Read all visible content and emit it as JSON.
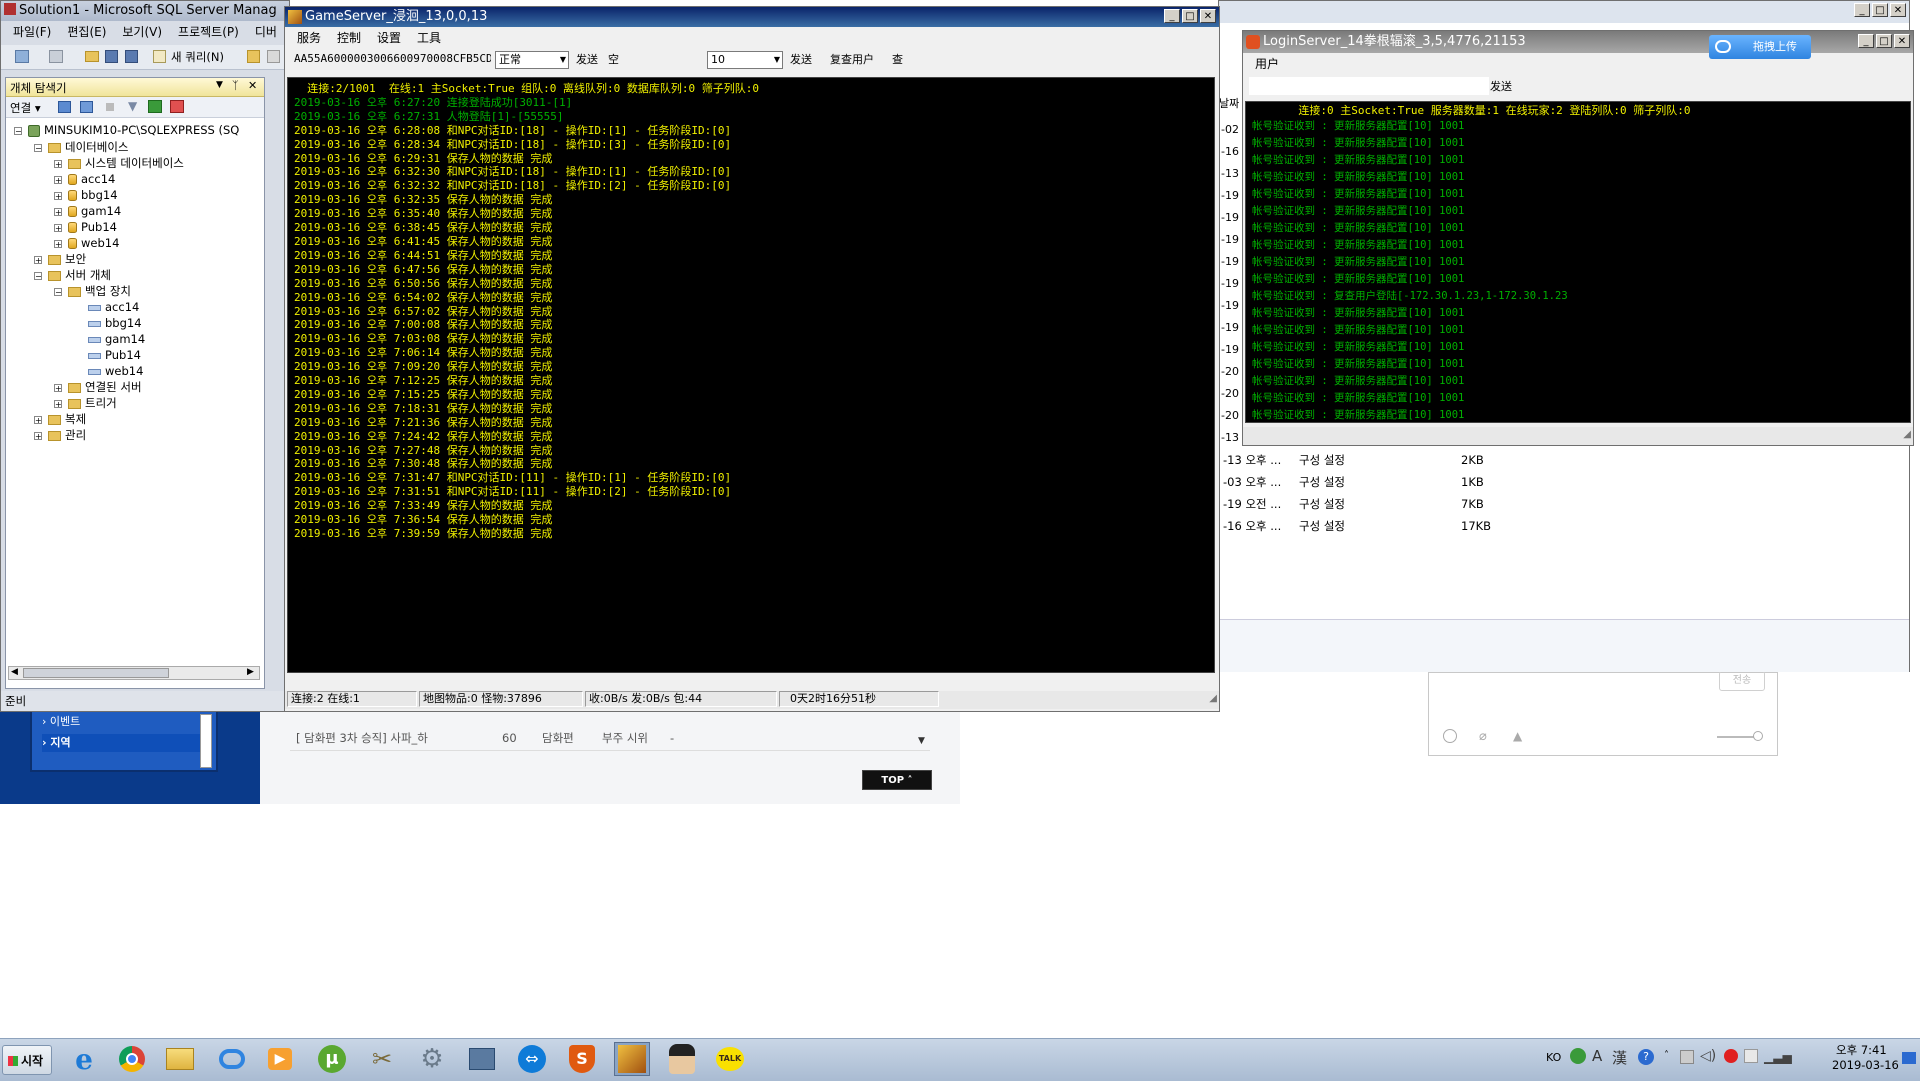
{
  "ssms": {
    "title": "Solution1 - Microsoft SQL Server Manag",
    "menu": [
      "파일(F)",
      "편집(E)",
      "보기(V)",
      "프로젝트(P)",
      "디버"
    ],
    "new_query": "새 쿼리(N)",
    "explorer_title": "개체 탐색기",
    "connect_label": "연결",
    "status": "준비",
    "tree": [
      {
        "label": "MINSUKIM10-PC\\SQLEXPRESS (SQ",
        "icon": "server-icon",
        "level": 0
      },
      {
        "label": "데이터베이스",
        "icon": "folder-icon",
        "level": 1
      },
      {
        "label": "시스템 데이터베이스",
        "icon": "folder-icon",
        "level": 2
      },
      {
        "label": "acc14",
        "icon": "database-icon",
        "level": 2
      },
      {
        "label": "bbg14",
        "icon": "database-icon",
        "level": 2
      },
      {
        "label": "gam14",
        "icon": "database-icon",
        "level": 2
      },
      {
        "label": "Pub14",
        "icon": "database-icon",
        "level": 2
      },
      {
        "label": "web14",
        "icon": "database-icon",
        "level": 2
      },
      {
        "label": "보안",
        "icon": "folder-icon",
        "level": 1
      },
      {
        "label": "서버 개체",
        "icon": "folder-icon",
        "level": 1
      },
      {
        "label": "백업 장치",
        "icon": "folder-icon",
        "level": 2
      },
      {
        "label": "acc14",
        "icon": "backup-device-icon",
        "level": 3
      },
      {
        "label": "bbg14",
        "icon": "backup-device-icon",
        "level": 3
      },
      {
        "label": "gam14",
        "icon": "backup-device-icon",
        "level": 3
      },
      {
        "label": "Pub14",
        "icon": "backup-device-icon",
        "level": 3
      },
      {
        "label": "web14",
        "icon": "backup-device-icon",
        "level": 3
      },
      {
        "label": "연결된 서버",
        "icon": "folder-icon",
        "level": 2
      },
      {
        "label": "트리거",
        "icon": "folder-icon",
        "level": 2
      },
      {
        "label": "복제",
        "icon": "folder-icon",
        "level": 1
      },
      {
        "label": "관리",
        "icon": "folder-icon",
        "level": 1
      }
    ]
  },
  "game_server": {
    "title": "GameServer_浸洄_13,0,0,13",
    "menu": [
      "服务",
      "控制",
      "设置",
      "工具"
    ],
    "packet_field": "AA55A6000003006600970008CFB5CD",
    "mode_select": "正常",
    "send1": "发送",
    "space_label": "空",
    "count_field": "10",
    "send2": "发送",
    "query_user": "复查用户",
    "query_short": "查",
    "header_line": "  连接:2/1001  在线:1 主Socket:True 组队:0 离线队列:0 数据库队列:0 筛子列队:0",
    "log": [
      {
        "text": "2019-03-16 오후 6:27:20 连接登陆成功[3011-[1]",
        "color": "green"
      },
      {
        "text": "2019-03-16 오후 6:27:31 人物登陆[1]-[55555]",
        "color": "green"
      },
      {
        "text": "2019-03-16 오후 6:28:08 和NPC对话ID:[18] - 操作ID:[1] - 任务阶段ID:[0]",
        "color": "yellow"
      },
      {
        "text": "2019-03-16 오후 6:28:34 和NPC对话ID:[18] - 操作ID:[3] - 任务阶段ID:[0]",
        "color": "yellow"
      },
      {
        "text": "2019-03-16 오후 6:29:31 保存人物的数据 完成",
        "color": "yellow"
      },
      {
        "text": "2019-03-16 오후 6:32:30 和NPC对话ID:[18] - 操作ID:[1] - 任务阶段ID:[0]",
        "color": "yellow"
      },
      {
        "text": "2019-03-16 오후 6:32:32 和NPC对话ID:[18] - 操作ID:[2] - 任务阶段ID:[0]",
        "color": "yellow"
      },
      {
        "text": "2019-03-16 오후 6:32:35 保存人物的数据 完成",
        "color": "yellow"
      },
      {
        "text": "2019-03-16 오후 6:35:40 保存人物的数据 完成",
        "color": "yellow"
      },
      {
        "text": "2019-03-16 오후 6:38:45 保存人物的数据 完成",
        "color": "yellow"
      },
      {
        "text": "2019-03-16 오후 6:41:45 保存人物的数据 完成",
        "color": "yellow"
      },
      {
        "text": "2019-03-16 오후 6:44:51 保存人物的数据 完成",
        "color": "yellow"
      },
      {
        "text": "2019-03-16 오후 6:47:56 保存人物的数据 完成",
        "color": "yellow"
      },
      {
        "text": "2019-03-16 오후 6:50:56 保存人物的数据 完成",
        "color": "yellow"
      },
      {
        "text": "2019-03-16 오후 6:54:02 保存人物的数据 完成",
        "color": "yellow"
      },
      {
        "text": "2019-03-16 오후 6:57:02 保存人物的数据 完成",
        "color": "yellow"
      },
      {
        "text": "2019-03-16 오후 7:00:08 保存人物的数据 完成",
        "color": "yellow"
      },
      {
        "text": "2019-03-16 오후 7:03:08 保存人物的数据 完成",
        "color": "yellow"
      },
      {
        "text": "2019-03-16 오후 7:06:14 保存人物的数据 完成",
        "color": "yellow"
      },
      {
        "text": "2019-03-16 오후 7:09:20 保存人物的数据 完成",
        "color": "yellow"
      },
      {
        "text": "2019-03-16 오후 7:12:25 保存人物的数据 完成",
        "color": "yellow"
      },
      {
        "text": "2019-03-16 오후 7:15:25 保存人物的数据 完成",
        "color": "yellow"
      },
      {
        "text": "2019-03-16 오후 7:18:31 保存人物的数据 完成",
        "color": "yellow"
      },
      {
        "text": "2019-03-16 오후 7:21:36 保存人物的数据 完成",
        "color": "yellow"
      },
      {
        "text": "2019-03-16 오후 7:24:42 保存人物的数据 完成",
        "color": "yellow"
      },
      {
        "text": "2019-03-16 오후 7:27:48 保存人物的数据 完成",
        "color": "yellow"
      },
      {
        "text": "2019-03-16 오후 7:30:48 保存人物的数据 完成",
        "color": "yellow"
      },
      {
        "text": "2019-03-16 오후 7:31:47 和NPC对话ID:[11] - 操作ID:[1] - 任务阶段ID:[0]",
        "color": "yellow"
      },
      {
        "text": "2019-03-16 오후 7:31:51 和NPC对话ID:[11] - 操作ID:[2] - 任务阶段ID:[0]",
        "color": "yellow"
      },
      {
        "text": "2019-03-16 오후 7:33:49 保存人物的数据 完成",
        "color": "yellow"
      },
      {
        "text": "2019-03-16 오후 7:36:54 保存人物的数据 完成",
        "color": "yellow"
      },
      {
        "text": "2019-03-16 오후 7:39:59 保存人物的数据 完成",
        "color": "yellow"
      }
    ],
    "status": [
      "连接:2 在线:1",
      "地图物品:0 怪物:37896",
      "收:0B/s 发:0B/s 包:44",
      "0天2时16分51秒"
    ]
  },
  "login_server": {
    "title": "LoginServer_14拳根辐滚_3,5,4776,21153",
    "menu": [
      "用户"
    ],
    "send": "发送",
    "upload_label": "拖拽上传",
    "header_line": "       连接:0 主Socket:True 服务器数量:1 在线玩家:2 登陆列队:0 筛子列队:0",
    "log": [
      {
        "text": "帐号验证收到 : 更新服务器配置[10] 1001",
        "color": "green"
      },
      {
        "text": "帐号验证收到 : 更新服务器配置[10] 1001",
        "color": "green"
      },
      {
        "text": "帐号验证收到 : 更新服务器配置[10] 1001",
        "color": "green"
      },
      {
        "text": "帐号验证收到 : 更新服务器配置[10] 1001",
        "color": "green"
      },
      {
        "text": "帐号验证收到 : 更新服务器配置[10] 1001",
        "color": "green"
      },
      {
        "text": "帐号验证收到 : 更新服务器配置[10] 1001",
        "color": "green"
      },
      {
        "text": "帐号验证收到 : 更新服务器配置[10] 1001",
        "color": "green"
      },
      {
        "text": "帐号验证收到 : 更新服务器配置[10] 1001",
        "color": "green"
      },
      {
        "text": "帐号验证收到 : 更新服务器配置[10] 1001",
        "color": "green"
      },
      {
        "text": "帐号验证收到 : 更新服务器配置[10] 1001",
        "color": "green"
      },
      {
        "text": "帐号验证收到 : 复查用户登陆[-172.30.1.23,1-172.30.1.23",
        "color": "green"
      },
      {
        "text": "帐号验证收到 : 更新服务器配置[10] 1001",
        "color": "green"
      },
      {
        "text": "帐号验证收到 : 更新服务器配置[10] 1001",
        "color": "green"
      },
      {
        "text": "帐号验证收到 : 更新服务器配置[10] 1001",
        "color": "green"
      },
      {
        "text": "帐号验证收到 : 更新服务器配置[10] 1001",
        "color": "green"
      },
      {
        "text": "帐号验证收到 : 更新服务器配置[10] 1001",
        "color": "green"
      },
      {
        "text": "帐号验证收到 : 更新服务器配置[10] 1001",
        "color": "green"
      },
      {
        "text": "帐号验证收到 : 更新服务器配置[10] 1001",
        "color": "green"
      }
    ]
  },
  "explorer": {
    "header_fragment": "날짜",
    "date_fragments": [
      "-02",
      "-16",
      "-13",
      "-19",
      "-19",
      "-19",
      "-19",
      "-19",
      "-19",
      "-19",
      "-19",
      "-20",
      "-20",
      "-20",
      "-13"
    ],
    "files": [
      {
        "date": "-13 오후 ...",
        "type": "구성 설정",
        "size": "2KB"
      },
      {
        "date": "-03 오후 ...",
        "type": "구성 설정",
        "size": "1KB"
      },
      {
        "date": "-19 오전 ...",
        "type": "구성 설정",
        "size": "7KB"
      },
      {
        "date": "-16 오후 ...",
        "type": "구성 설정",
        "size": "17KB"
      }
    ]
  },
  "web_page": {
    "sidebar_items": [
      "이벤트",
      "지역"
    ],
    "row": {
      "name": "[ 담화편 3차 승직] 사파_하",
      "level": "60",
      "type": "담화편",
      "reward": "부주 시위",
      "extra": "-"
    },
    "top_button": "TOP",
    "chat_send": "전송"
  },
  "taskbar": {
    "start": "시작",
    "icons": [
      "ie-icon",
      "chrome-icon",
      "explorer-folder-icon",
      "baidu-cloud-icon",
      "media-player-icon",
      "utorrent-icon",
      "tools-icon",
      "settings-icon",
      "network-icon",
      "teamviewer-icon",
      "game-shield-icon",
      "game-server-icon",
      "character-icon",
      "kakaotalk-icon"
    ],
    "kakao_label": "TALK",
    "lang": "KO",
    "ime": [
      "A",
      "漢"
    ],
    "time": "오후 7:41",
    "date": "2019-03-16"
  },
  "colors": {
    "console_yellow": "#f0f000",
    "console_green": "#00b000",
    "title_active": "#0a246a",
    "web_blue": "#0a3a8a"
  }
}
